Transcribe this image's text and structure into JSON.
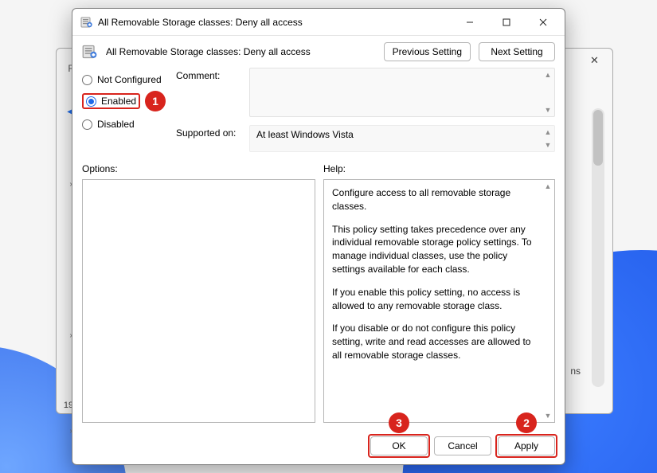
{
  "window": {
    "title": "All Removable Storage classes: Deny all access"
  },
  "header": {
    "policy_name": "All Removable Storage classes: Deny all access",
    "prev_btn": "Previous Setting",
    "next_btn": "Next Setting"
  },
  "state": {
    "options": [
      "Not Configured",
      "Enabled",
      "Disabled"
    ],
    "selected_index": 1
  },
  "fields": {
    "comment_label": "Comment:",
    "comment_value": "",
    "supported_label": "Supported on:",
    "supported_value": "At least Windows Vista"
  },
  "panes": {
    "options_label": "Options:",
    "help_label": "Help:"
  },
  "help": {
    "p1": "Configure access to all removable storage classes.",
    "p2": "This policy setting takes precedence over any individual removable storage policy settings. To manage individual classes, use the policy settings available for each class.",
    "p3": "If you enable this policy setting, no access is allowed to any removable storage class.",
    "p4": "If you disable or do not configure this policy setting, write and read accesses are allowed to all removable storage classes."
  },
  "footer": {
    "ok": "OK",
    "cancel": "Cancel",
    "apply": "Apply"
  },
  "annotations": {
    "step1": "1",
    "step2": "2",
    "step3": "3"
  },
  "back_window": {
    "partial_text": "ns",
    "bottom_num": "19",
    "top_letter": "F"
  }
}
